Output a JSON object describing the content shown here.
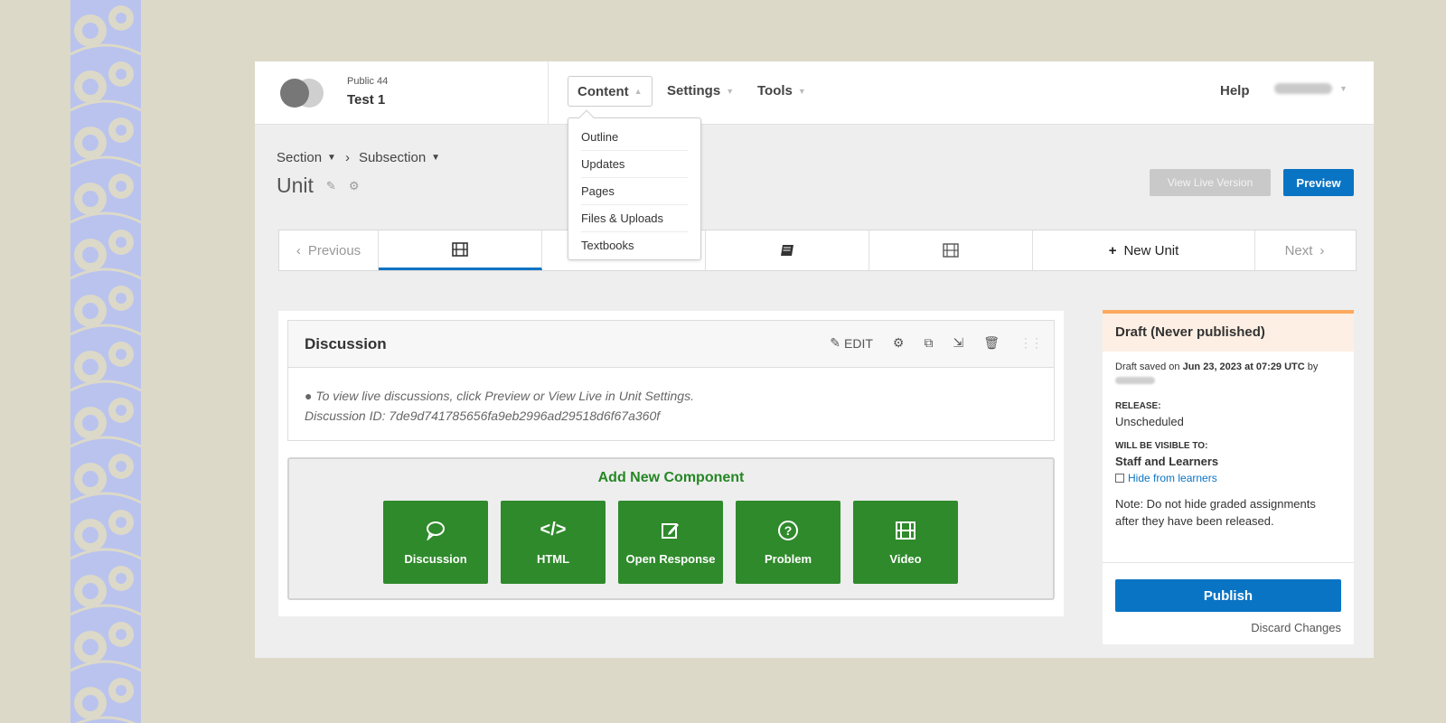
{
  "header": {
    "course_org": "Public 44",
    "course_title": "Test 1",
    "nav": {
      "content": "Content",
      "settings": "Settings",
      "tools": "Tools",
      "help": "Help"
    },
    "content_menu": [
      "Outline",
      "Updates",
      "Pages",
      "Files & Uploads",
      "Textbooks"
    ]
  },
  "breadcrumbs": {
    "section": "Section",
    "subsection": "Subsection"
  },
  "unit_title": "Unit",
  "buttons": {
    "view_live": "View Live Version",
    "preview": "Preview"
  },
  "sequence": {
    "previous": "Previous",
    "new_unit": "New Unit",
    "next": "Next",
    "tabs": [
      "video-icon",
      "html-icon",
      "book-icon",
      "video-icon"
    ]
  },
  "xblock": {
    "title": "Discussion",
    "edit_label": "EDIT",
    "body_line1": "To view live discussions, click Preview or View Live in Unit Settings.",
    "body_line2": "Discussion ID: 7de9d741785656fa9eb2996ad29518d6f67a360f"
  },
  "add_component": {
    "title": "Add New Component",
    "items": [
      {
        "label": "Discussion",
        "icon": "speech-bubble-icon"
      },
      {
        "label": "HTML",
        "icon": "code-icon"
      },
      {
        "label": "Open Response",
        "icon": "edit-icon"
      },
      {
        "label": "Problem",
        "icon": "question-icon"
      },
      {
        "label": "Video",
        "icon": "film-icon"
      }
    ]
  },
  "sidebar": {
    "status": "Draft (Never published)",
    "draft_saved_prefix": "Draft saved on ",
    "draft_saved_date": "Jun 23, 2023 at 07:29 UTC",
    "draft_saved_suffix": " by",
    "release_label": "RELEASE:",
    "release_value": "Unscheduled",
    "visible_label": "WILL BE VISIBLE TO:",
    "visible_value": "Staff and Learners",
    "hide_link": "Hide from learners",
    "note": "Note: Do not hide graded assignments after they have been released.",
    "publish": "Publish",
    "discard": "Discard Changes"
  },
  "colors": {
    "primary": "#0a74c4",
    "green": "#2f8a2b",
    "draft_accent": "#fda95f"
  }
}
